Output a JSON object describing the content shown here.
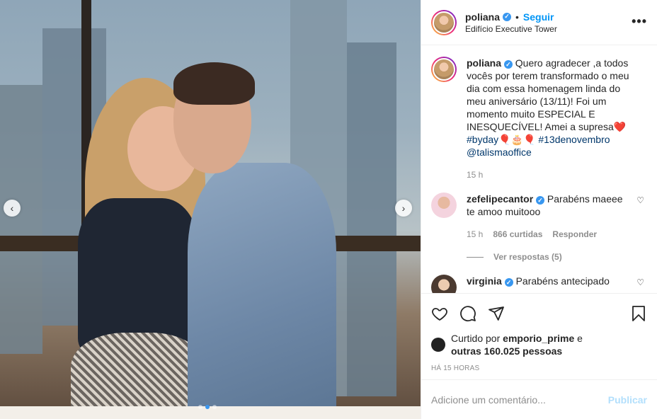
{
  "post": {
    "carousel": {
      "prev_icon": "‹",
      "next_icon": "›",
      "slide_count": 3,
      "active_slide": 2
    }
  },
  "header": {
    "username": "poliana",
    "verified_icon": "✓",
    "separator": "•",
    "follow_label": "Seguir",
    "location": "Edifício Executive Tower",
    "more_icon": "•••"
  },
  "caption": {
    "username": "poliana",
    "text_before": " Quero agradecer ,a todos vocês por terem transformado o meu dia com essa homenagem linda do meu aniversário (13/11)! Foi um momento muito ESPECIAL E INESQUECÍVEL! Amei a supresa❤️ ",
    "hashtag1": "#byday",
    "emoji": "🎈🎂🎈",
    "hashtag2": "#13denovembro",
    "mention": "@talismaoffice",
    "time": "15 h"
  },
  "comments": [
    {
      "username": "zefelipecantor",
      "text": " Parabéns maeee te amoo muitooo",
      "time": "15 h",
      "likes": "866 curtidas",
      "reply_label": "Responder",
      "view_replies": "Ver respostas (5)"
    },
    {
      "username": "virginia",
      "text": " Parabéns antecipado"
    }
  ],
  "actions": {
    "liked_prefix": "Curtido por ",
    "liked_user": "emporio_prime",
    "liked_and": " e",
    "liked_others": "outras 160.025 pessoas",
    "time_ago": "HÁ 15 HORAS"
  },
  "add_comment": {
    "placeholder": "Adicione um comentário...",
    "publish_label": "Publicar"
  },
  "colors": {
    "accent": "#0095f6",
    "verified": "#3897f0",
    "publish_disabled": "#b2dffc"
  }
}
